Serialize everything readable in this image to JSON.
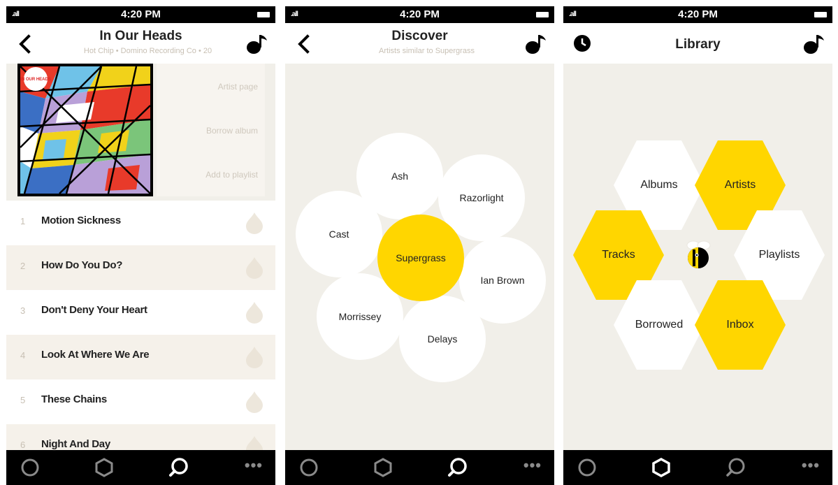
{
  "status": {
    "time": "4:20 PM",
    "signal": ".all"
  },
  "album_screen": {
    "title": "In Our Heads",
    "subtitle": "Hot Chip • Domino Recording Co • 20",
    "cover_text": "IN OUR HEADS",
    "actions": [
      "Artist page",
      "Borrow album",
      "Add to playlist"
    ],
    "tracks": [
      {
        "num": "1",
        "name": "Motion Sickness"
      },
      {
        "num": "2",
        "name": "How Do You Do?"
      },
      {
        "num": "3",
        "name": "Don't Deny Your Heart"
      },
      {
        "num": "4",
        "name": "Look At Where We Are"
      },
      {
        "num": "5",
        "name": "These Chains"
      },
      {
        "num": "6",
        "name": "Night And Day"
      }
    ]
  },
  "discover_screen": {
    "title": "Discover",
    "subtitle": "Artists similar to Supergrass",
    "bubbles": {
      "ash": "Ash",
      "razorlight": "Razorlight",
      "cast": "Cast",
      "supergrass": "Supergrass",
      "ian_brown": "Ian Brown",
      "morrissey": "Morrissey",
      "delays": "Delays"
    }
  },
  "library_screen": {
    "title": "Library",
    "items": {
      "albums": "Albums",
      "artists": "Artists",
      "tracks": "Tracks",
      "playlists": "Playlists",
      "borrowed": "Borrowed",
      "inbox": "Inbox"
    }
  },
  "tabbar": {
    "more": "•••"
  },
  "colors": {
    "accent": "#ffd600",
    "background": "#f1efe9",
    "muted_text": "#c8c0b4"
  }
}
